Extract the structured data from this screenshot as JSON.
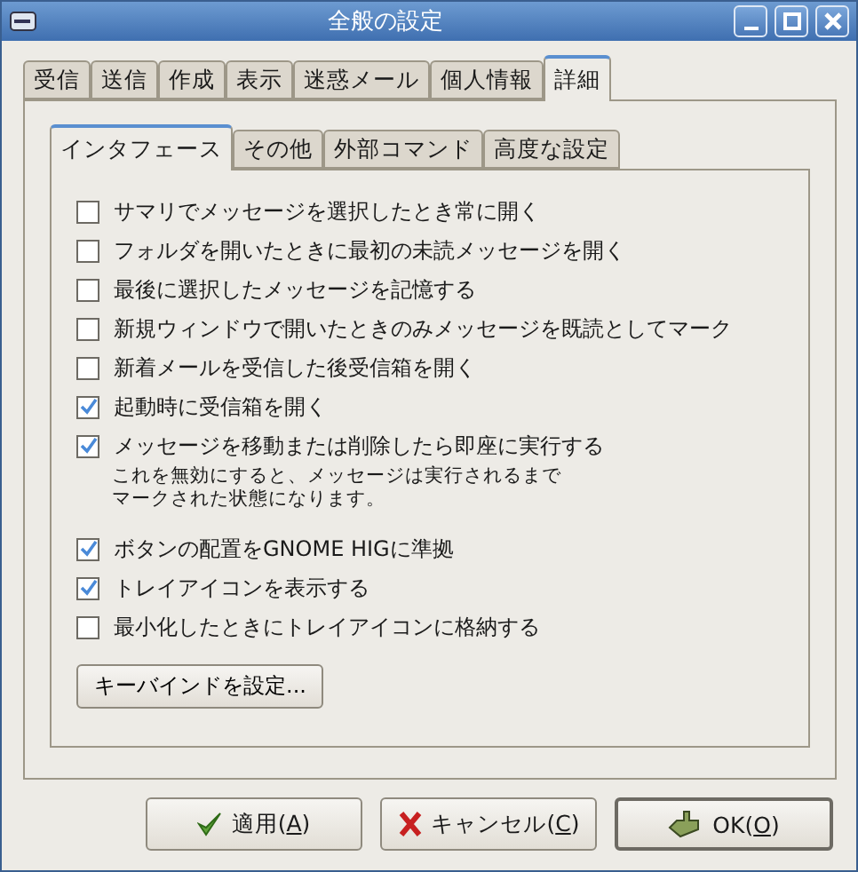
{
  "window": {
    "title": "全般の設定"
  },
  "tabs": [
    {
      "label": "受信",
      "selected": false
    },
    {
      "label": "送信",
      "selected": false
    },
    {
      "label": "作成",
      "selected": false
    },
    {
      "label": "表示",
      "selected": false
    },
    {
      "label": "迷惑メール",
      "selected": false
    },
    {
      "label": "個人情報",
      "selected": false
    },
    {
      "label": "詳細",
      "selected": true
    }
  ],
  "subtabs": [
    {
      "label": "インタフェース",
      "selected": true
    },
    {
      "label": "その他",
      "selected": false
    },
    {
      "label": "外部コマンド",
      "selected": false
    },
    {
      "label": "高度な設定",
      "selected": false
    }
  ],
  "options": [
    {
      "label": "サマリでメッセージを選択したとき常に開く",
      "checked": false
    },
    {
      "label": "フォルダを開いたときに最初の未読メッセージを開く",
      "checked": false
    },
    {
      "label": "最後に選択したメッセージを記憶する",
      "checked": false
    },
    {
      "label": "新規ウィンドウで開いたときのみメッセージを既読としてマーク",
      "checked": false
    },
    {
      "label": "新着メールを受信した後受信箱を開く",
      "checked": false
    },
    {
      "label": "起動時に受信箱を開く",
      "checked": true
    },
    {
      "label": "メッセージを移動または削除したら即座に実行する",
      "checked": true,
      "note": [
        "これを無効にすると、メッセージは実行されるまで",
        "マークされた状態になります。"
      ]
    },
    {
      "label": "ボタンの配置をGNOME HIGに準拠",
      "checked": true
    },
    {
      "label": "トレイアイコンを表示する",
      "checked": true
    },
    {
      "label": "最小化したときにトレイアイコンに格納する",
      "checked": false
    }
  ],
  "keybind_button": "キーバインドを設定...",
  "buttons": [
    {
      "kind": "apply",
      "before": "適用(",
      "mnemonic": "A",
      "after": ")"
    },
    {
      "kind": "cancel",
      "before": "キャンセル(",
      "mnemonic": "C",
      "after": ")"
    },
    {
      "kind": "ok",
      "before": "OK(",
      "mnemonic": "O",
      "after": ")"
    }
  ]
}
